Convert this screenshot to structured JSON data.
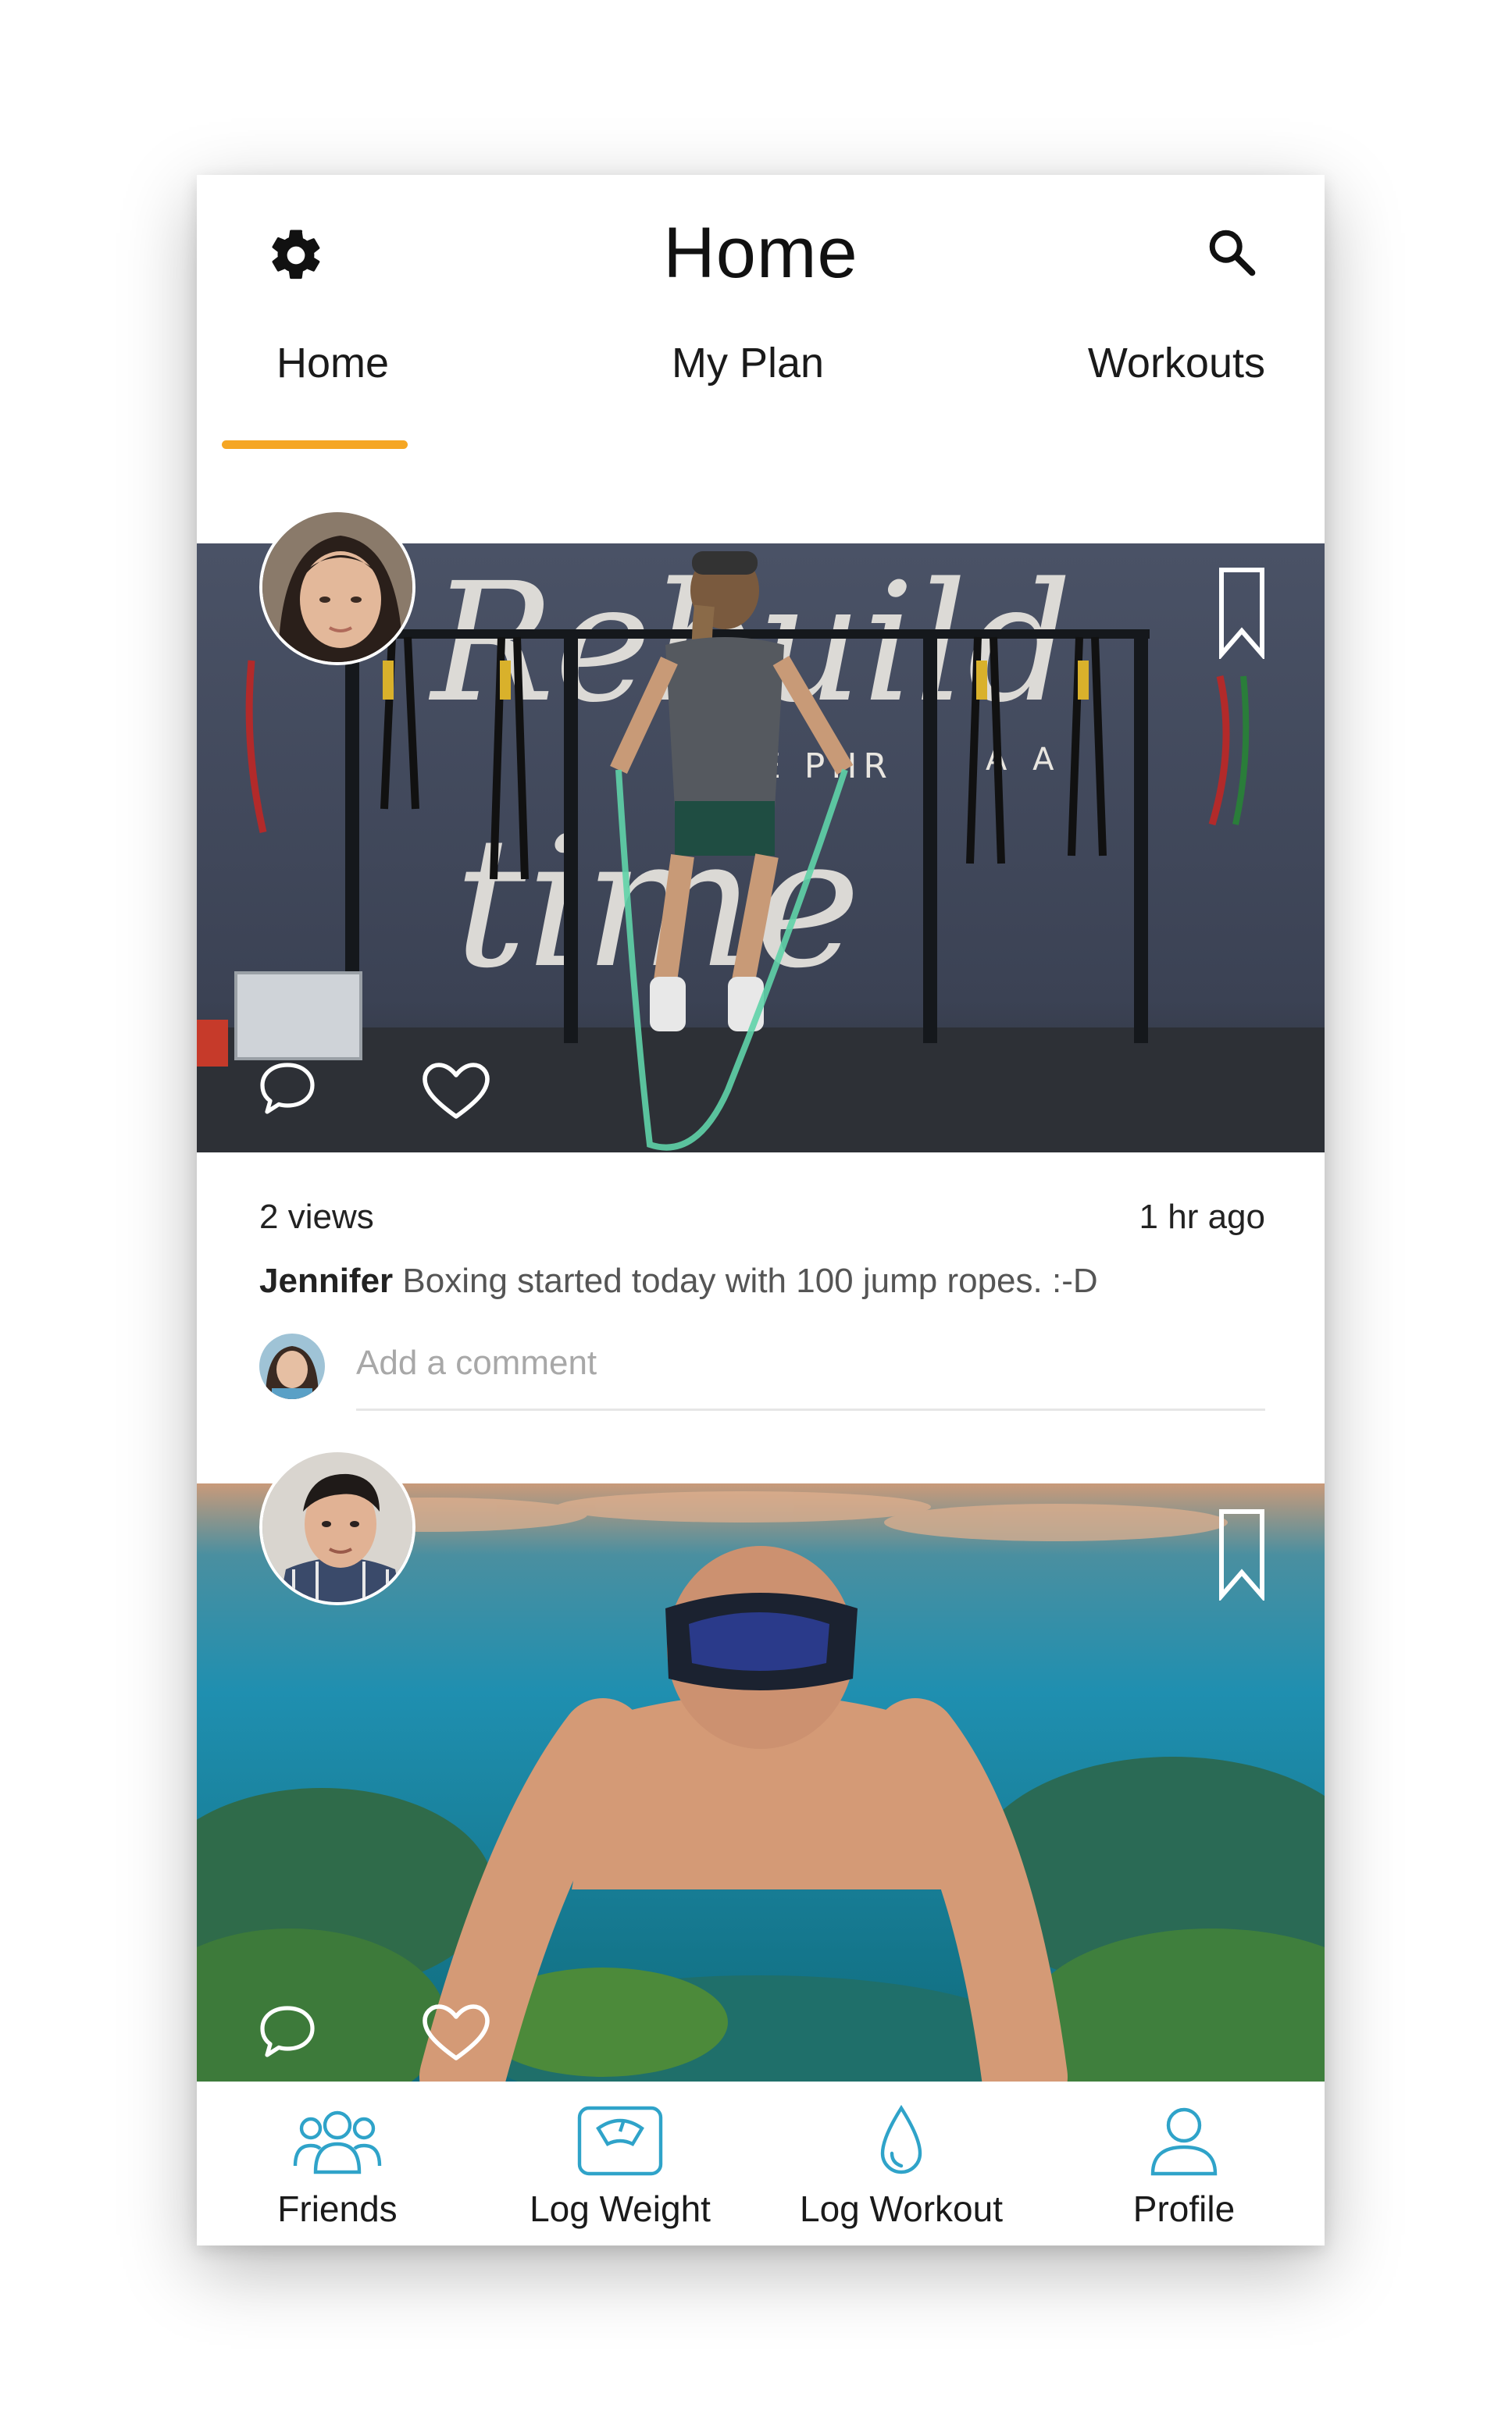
{
  "header": {
    "title": "Home",
    "settings_icon": "gear-icon",
    "search_icon": "search-icon"
  },
  "tabs": [
    {
      "label": "Home",
      "active": true
    },
    {
      "label": "My Plan",
      "active": false
    },
    {
      "label": "Workouts",
      "active": false
    }
  ],
  "colors": {
    "accent": "#f5a623",
    "nav_icon": "#2fa3c9",
    "text": "#1a1a1a",
    "placeholder": "#a8a8a8"
  },
  "posts": [
    {
      "views": "2 views",
      "time": "1 hr ago",
      "author": "Jennifer",
      "caption": "Boxing started today with 100 jump ropes. :-D",
      "comment_placeholder": "Add a comment",
      "image_text": [
        "Rebuild",
        "E PHR",
        "A A",
        "time"
      ]
    },
    {
      "views": "",
      "time": "",
      "author": "",
      "caption": ""
    }
  ],
  "bottom_nav": [
    {
      "label": "Friends",
      "icon": "friends-icon"
    },
    {
      "label": "Log Weight",
      "icon": "scale-icon"
    },
    {
      "label": "Log Workout",
      "icon": "water-drop-icon"
    },
    {
      "label": "Profile",
      "icon": "profile-icon"
    }
  ]
}
